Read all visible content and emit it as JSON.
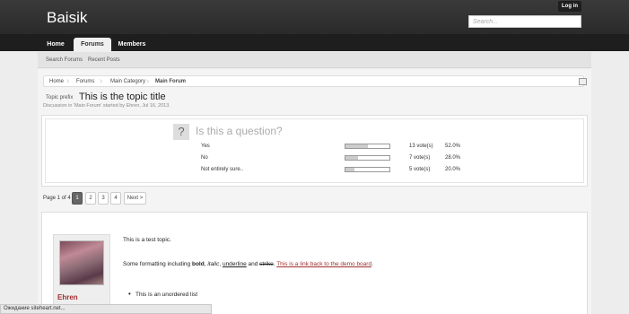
{
  "header": {
    "logo": "Baisik",
    "login_label": "Log in",
    "search_placeholder": "Search..."
  },
  "nav": {
    "tabs": [
      {
        "label": "Home"
      },
      {
        "label": "Forums"
      },
      {
        "label": "Members"
      }
    ],
    "active_tab": "Forums"
  },
  "subnav": {
    "links": [
      {
        "label": "Search Forums"
      },
      {
        "label": "Recent Posts"
      }
    ]
  },
  "breadcrumb": {
    "items": [
      {
        "label": "Home"
      },
      {
        "label": "Forums"
      },
      {
        "label": "Main Category"
      },
      {
        "label": "Main Forum"
      }
    ]
  },
  "thread": {
    "prefix": "Topic prefix",
    "title": "This is the topic title",
    "meta": "Discussion in 'Main Forum' started by Ehren, Jul 16, 2013."
  },
  "poll": {
    "question": "Is this a question?",
    "options": [
      {
        "label": "Yes",
        "votes": "13 vote(s)",
        "percent": "52.0%",
        "fraction": 0.52
      },
      {
        "label": "No",
        "votes": "7 vote(s)",
        "percent": "28.0%",
        "fraction": 0.28
      },
      {
        "label": "Not entirely sure..",
        "votes": "5 vote(s)",
        "percent": "20.0%",
        "fraction": 0.2
      }
    ]
  },
  "pagination": {
    "label": "Page 1 of 4",
    "pages": [
      "1",
      "2",
      "3",
      "4"
    ],
    "current": "1",
    "next_label": "Next >"
  },
  "post": {
    "author": "Ehren",
    "intro": "This is a test topic.",
    "format_prefix": "Some formatting including ",
    "bold": "bold",
    "sep1": ", ",
    "italic": "italic",
    "sep2": ", ",
    "underline": "underline",
    "sep3": " and ",
    "strike": "strike",
    "sep4": ". ",
    "link": "This is a link back to the demo board",
    "end": ".",
    "list_item": "This is an unordered list"
  },
  "statusbar": {
    "text": "Ожидание siteheart.net..."
  }
}
